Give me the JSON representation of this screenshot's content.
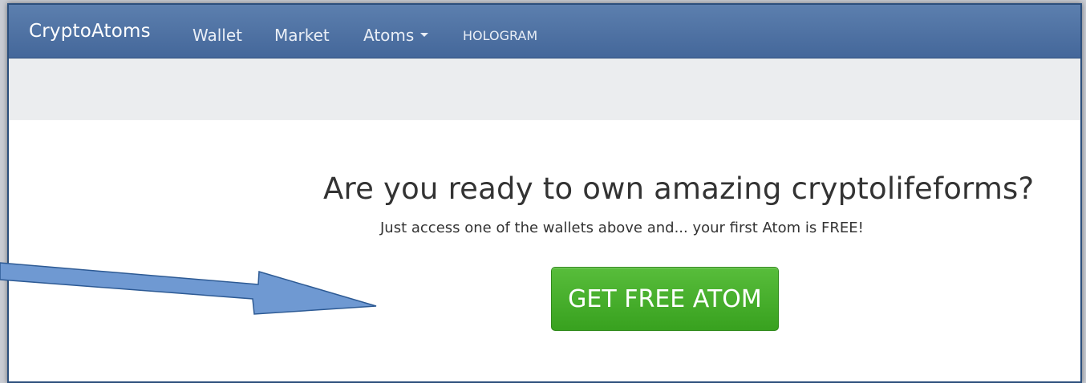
{
  "navbar": {
    "brand": "CryptoAtoms",
    "items": [
      {
        "label": "Wallet"
      },
      {
        "label": "Market"
      },
      {
        "label": "Atoms"
      },
      {
        "label": "HOLOGRAM"
      }
    ]
  },
  "hero": {
    "title": "Are you ready to own amazing cryptolifeforms?",
    "subtitle": "Just access one of the wallets above and... your first Atom is FREE!",
    "cta_label": "GET FREE ATOM"
  },
  "colors": {
    "navbar": "#4f72a4",
    "subbar": "#ebedef",
    "cta": "#45ad2b",
    "arrow_fill": "#6f99d2",
    "arrow_stroke": "#2d5a94"
  },
  "annotation": {
    "icon": "arrow-icon"
  }
}
